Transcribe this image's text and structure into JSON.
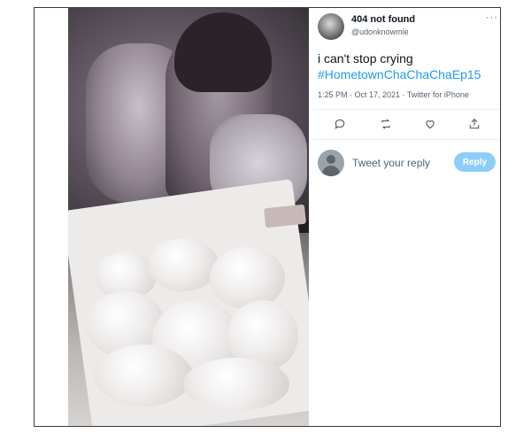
{
  "tweet": {
    "display_name": "404 not found",
    "handle": "@udonknowmie",
    "text_line1": "i can't stop crying",
    "text_line2": "#HometownChaChaChaEp15",
    "meta": "1:25 PM · Oct 17, 2021 · Twitter for iPhone",
    "more_icon": "more-horizontal-icon",
    "actions": [
      "reply-icon",
      "retweet-icon",
      "like-icon",
      "share-icon"
    ]
  },
  "reply": {
    "placeholder": "Tweet your reply",
    "button_label": "Reply"
  },
  "colors": {
    "link": "#1d9bf0",
    "reply_button": "#8ecdf8",
    "text": "#0f1419",
    "muted": "#536471"
  }
}
